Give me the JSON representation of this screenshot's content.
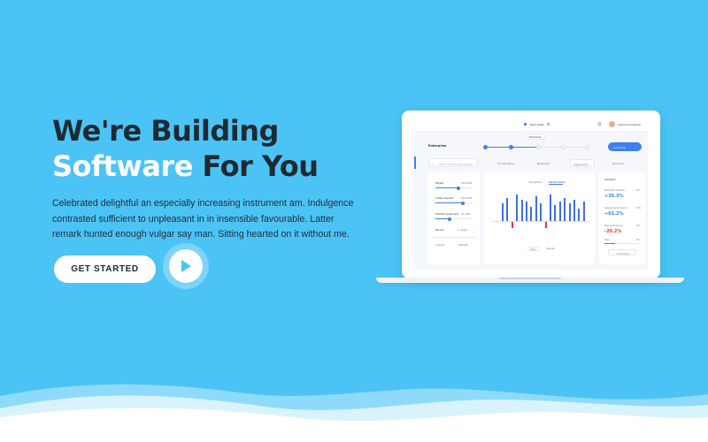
{
  "hero": {
    "title_line1": "We're Building",
    "title_highlight": "Software",
    "title_rest": " For You",
    "description": "Celebrated delightful an especially increasing instrument am. Indulgence contrasted sufficient to unpleasant in in insensible favourable. Latter remark hunted enough vulgar say man. Sitting hearted on it without me.",
    "cta_label": "GET STARTED",
    "play_icon": "play-icon"
  },
  "colors": {
    "background": "#4cc3f5",
    "title_dark": "#1e2a33",
    "title_highlight": "#ffffff",
    "accent_blue": "#3f7ef0",
    "negative_red": "#e5394a",
    "positive_blue": "#3f7ef0"
  },
  "dashboard": {
    "topbar": {
      "tab_label": "New Asset",
      "tooltip": "Enterprise",
      "user_name": "Cameron Dawson",
      "icons": [
        "home-icon",
        "bell-icon",
        "avatar"
      ]
    },
    "header_title": "Enterprise",
    "continue_button": "Continue",
    "search_placeholder": "What are the last assets?",
    "filters": [
      "Conservative",
      "Balanced",
      "Aggressive",
      "Dynamic"
    ],
    "left_panel": {
      "target_label": "Target",
      "target_value": "$50,000",
      "initial_label": "Initial deposit",
      "initial_value": "$10,000",
      "monthly_label": "Monthly payment",
      "monthly_value": "$1,000",
      "period_label": "Period",
      "period_value": "5 years",
      "footer_left": "Cancel",
      "footer_right": "Refresh"
    },
    "chart_tabs": [
      "Projection",
      "Performance"
    ],
    "chart_footer": [
      "Value",
      "Results"
    ],
    "right_panel": {
      "title": "Updates",
      "stats": [
        {
          "label": "Estimated portfolio",
          "value": "+35.3%",
          "badge": "6%"
        },
        {
          "label": "Savings performance",
          "value": "+61.2%",
          "badge": "12%"
        },
        {
          "label": "Risk performance",
          "value": "-20.2%",
          "badge": "4%"
        }
      ],
      "risk_label": "Risk",
      "risk_value": "8%",
      "button": "Summary"
    }
  }
}
